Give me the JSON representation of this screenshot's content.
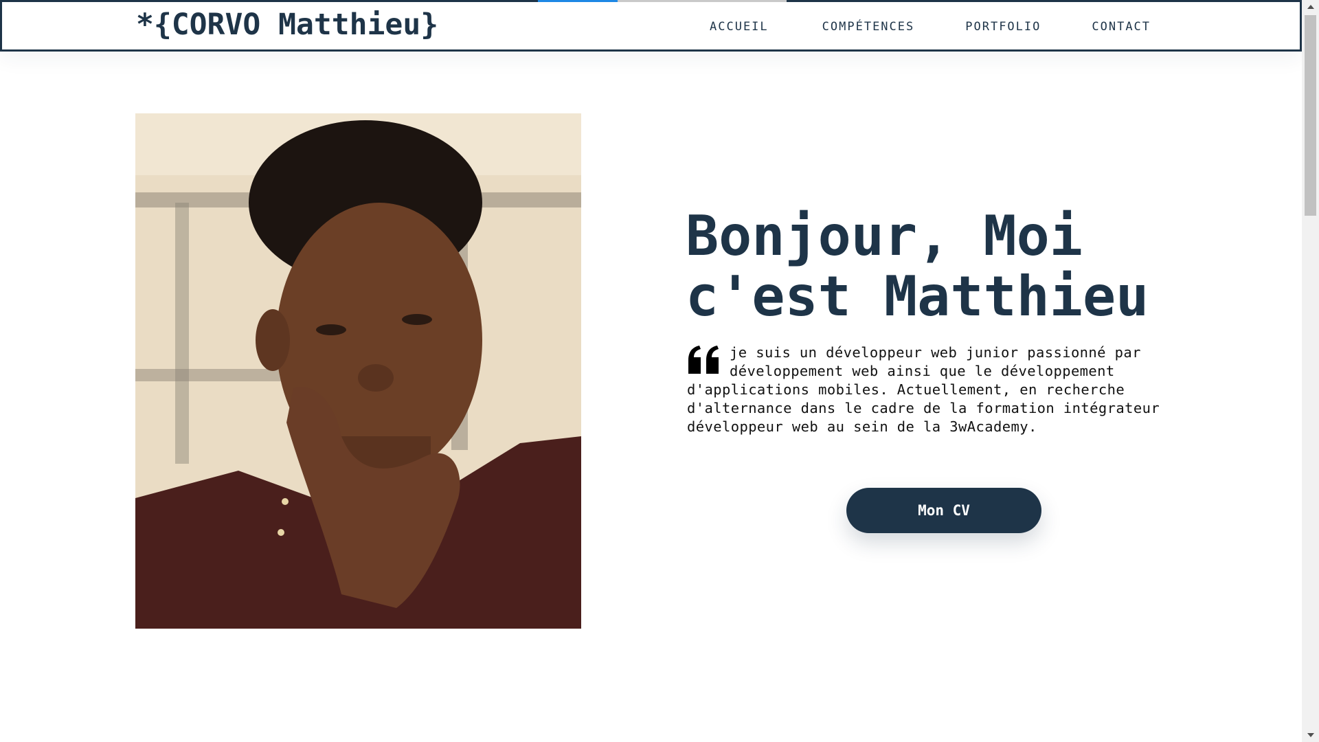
{
  "header": {
    "logo": "*{CORVO Matthieu}",
    "nav": [
      {
        "label": "ACCUEIL"
      },
      {
        "label": "COMPÉTENCES"
      },
      {
        "label": "PORTFOLIO"
      },
      {
        "label": "CONTACT"
      }
    ],
    "scroll_progress_percent": 32
  },
  "hero": {
    "headline_line1": "Bonjour, Moi",
    "headline_line2": "c'est Matthieu",
    "intro": "je suis un développeur web junior passionné par développement web ainsi que le développement d'applications mobiles. Actuellement, en recherche d'alternance dans le cadre de la formation intégrateur développeur web au sein de la 3wAcademy.",
    "cv_button": "Mon CV",
    "quote_icon": "quote-left-icon"
  },
  "colors": {
    "primary": "#1e3448",
    "accent": "#1e88e5",
    "background": "#ffffff"
  }
}
